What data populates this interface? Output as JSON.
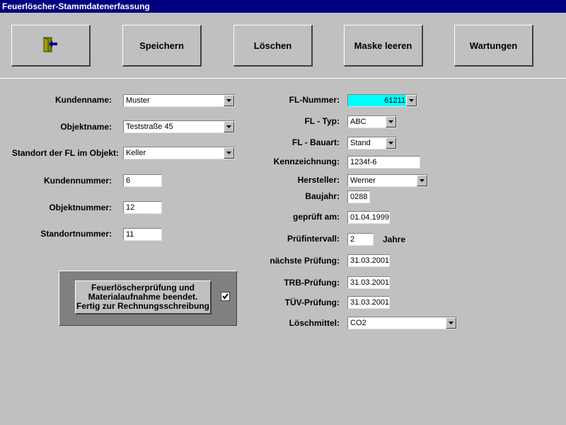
{
  "window": {
    "title": "Feuerlöscher-Stammdatenerfassung"
  },
  "toolbar": {
    "exit_icon": "exit-door-icon",
    "save_label": "Speichern",
    "delete_label": "Löschen",
    "clear_label": "Maske leeren",
    "maintenance_label": "Wartungen"
  },
  "left": {
    "kundenname": {
      "label": "Kundenname:",
      "value": "Muster"
    },
    "objektname": {
      "label": "Objektname:",
      "value": "Teststraße 45"
    },
    "standort": {
      "label": "Standort der FL im Objekt:",
      "value": "Keller"
    },
    "kundennummer": {
      "label": "Kundennummer:",
      "value": "6"
    },
    "objektnummer": {
      "label": "Objektnummer:",
      "value": "12"
    },
    "standortnummer": {
      "label": "Standortnummer:",
      "value": "11"
    }
  },
  "finish": {
    "line1": "Feuerlöscherprüfung und",
    "line2": "Materialaufnahme beendet.",
    "line3": "Fertig zur Rechnungsschreibung",
    "checked": true
  },
  "right": {
    "fl_nummer": {
      "label": "FL-Nummer:",
      "value": "61211"
    },
    "fl_typ": {
      "label": "FL - Typ:",
      "value": "ABC"
    },
    "fl_bauart": {
      "label": "FL - Bauart:",
      "value": "Stand"
    },
    "kennzeichnung": {
      "label": "Kennzeichnung:",
      "value": "1234f-6"
    },
    "hersteller": {
      "label": "Hersteller:",
      "value": "Werner"
    },
    "baujahr": {
      "label": "Baujahr:",
      "value": "0288"
    },
    "geprueft": {
      "label": "geprüft am:",
      "value": "01.04.1999"
    },
    "pruefintervall": {
      "label": "Prüfintervall:",
      "value": "2",
      "unit": "Jahre"
    },
    "naechste": {
      "label": "nächste Prüfung:",
      "value": "31.03.2001"
    },
    "trb": {
      "label": "TRB-Prüfung:",
      "value": "31.03.2001"
    },
    "tuev": {
      "label": "TÜV-Prüfung:",
      "value": "31.03.2001"
    },
    "loeschmittel": {
      "label": "Löschmittel:",
      "value": "CO2"
    }
  },
  "colors": {
    "title_bar": "#000080",
    "highlight_field": "#00ffff",
    "panel": "#808080"
  }
}
